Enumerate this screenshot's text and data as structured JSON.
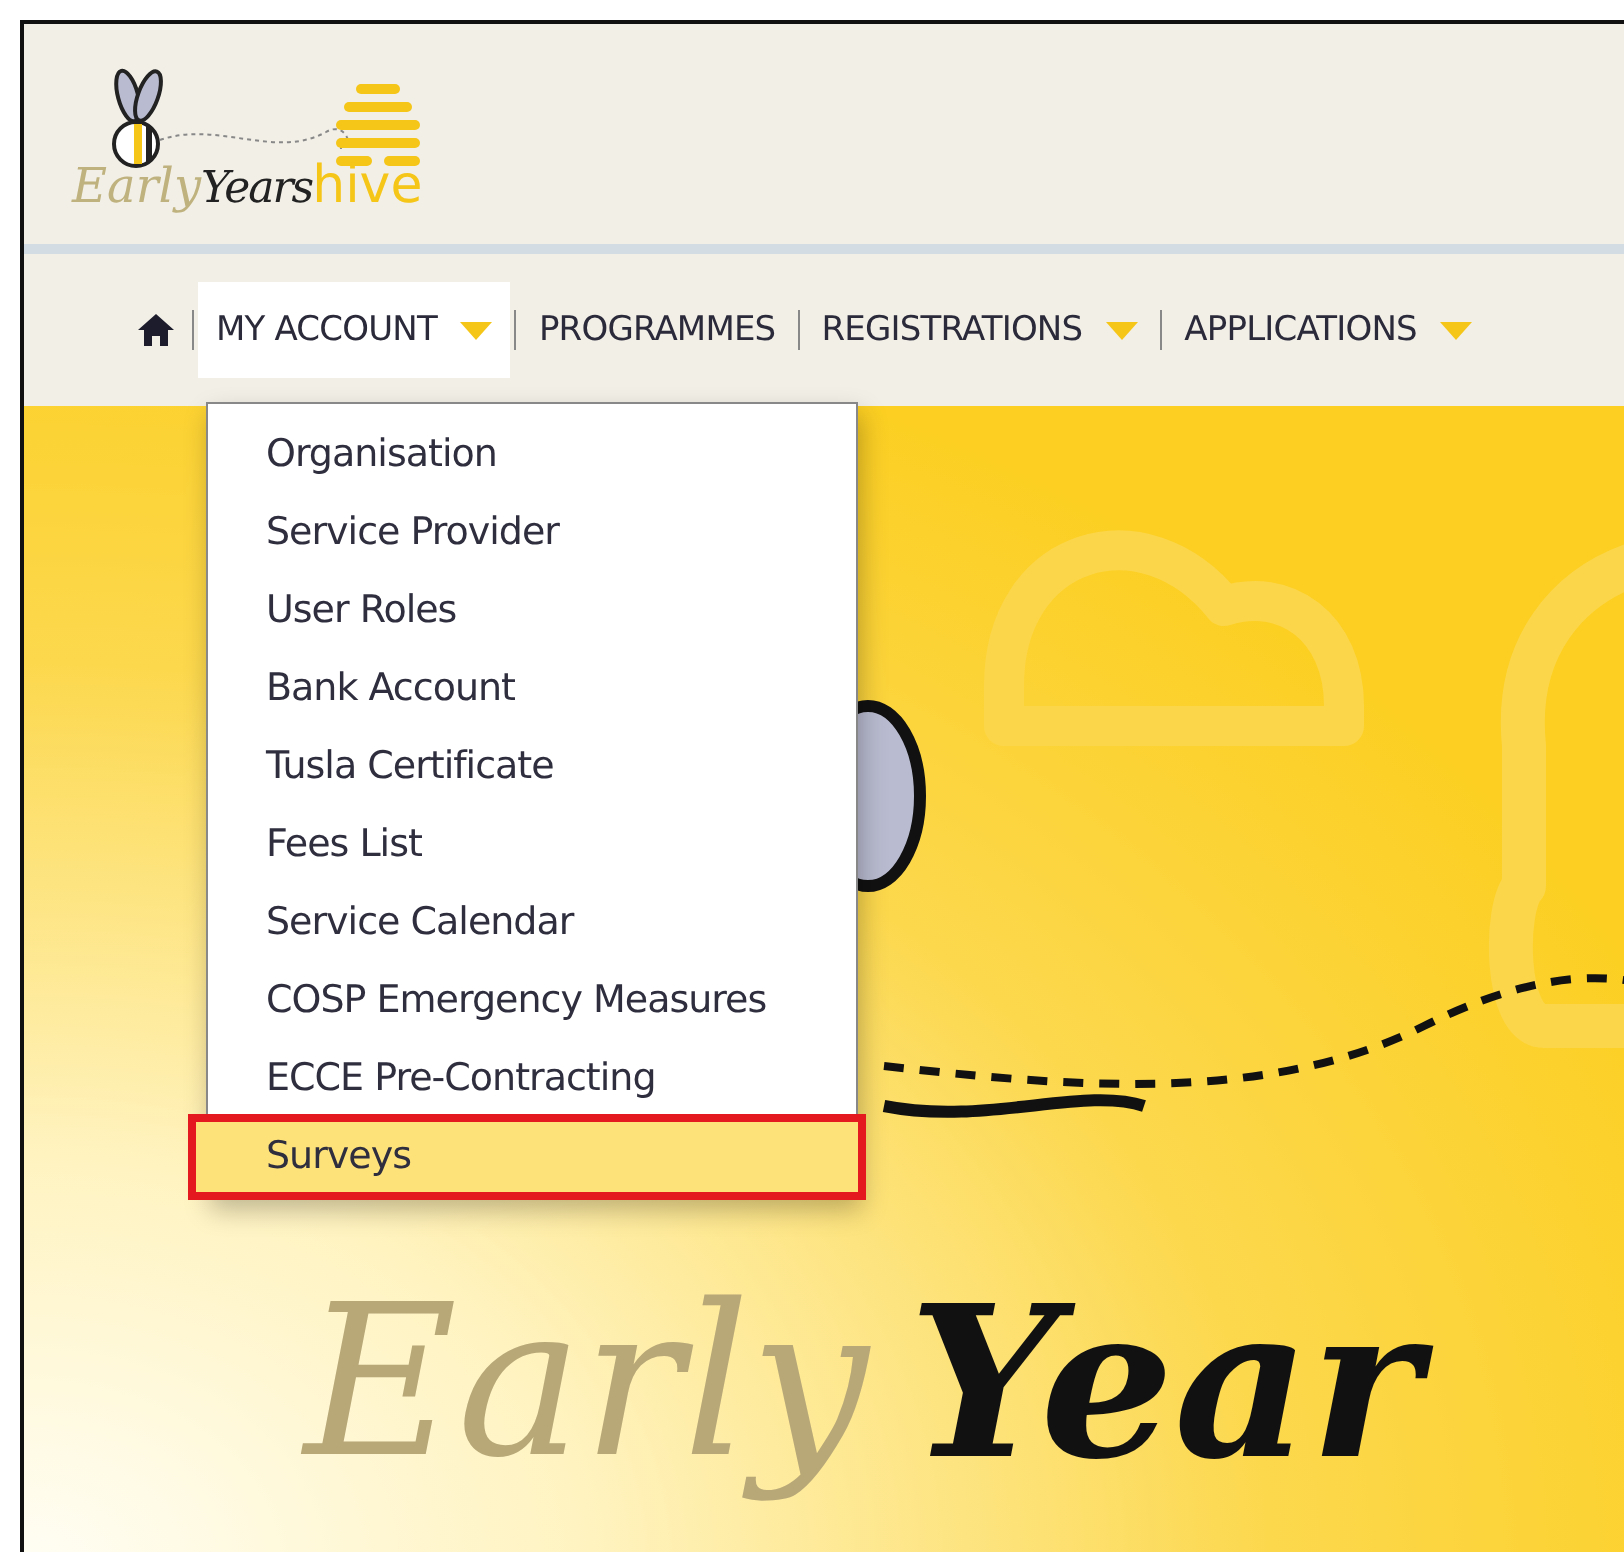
{
  "logo": {
    "word_1": "Early",
    "word_2": "Years",
    "word_3": "hive"
  },
  "nav": {
    "items": [
      {
        "label": "MY ACCOUNT",
        "selected": true,
        "has_dropdown": true
      },
      {
        "label": "PROGRAMMES",
        "selected": false,
        "has_dropdown": false
      },
      {
        "label": "REGISTRATIONS",
        "selected": false,
        "has_dropdown": true
      },
      {
        "label": "APPLICATIONS",
        "selected": false,
        "has_dropdown": true
      }
    ]
  },
  "dropdown": {
    "items": [
      {
        "label": "Organisation",
        "selected": false
      },
      {
        "label": "Service Provider",
        "selected": false
      },
      {
        "label": "User Roles",
        "selected": false
      },
      {
        "label": "Bank Account",
        "selected": false
      },
      {
        "label": "Tusla Certificate",
        "selected": false
      },
      {
        "label": "Fees List",
        "selected": false
      },
      {
        "label": "Service Calendar",
        "selected": false
      },
      {
        "label": "COSP Emergency Measures",
        "selected": false
      },
      {
        "label": "ECCE Pre-Contracting",
        "selected": false
      },
      {
        "label": "Surveys",
        "selected": true
      }
    ]
  },
  "hero": {
    "word_1": "Early",
    "word_2": "Year"
  }
}
